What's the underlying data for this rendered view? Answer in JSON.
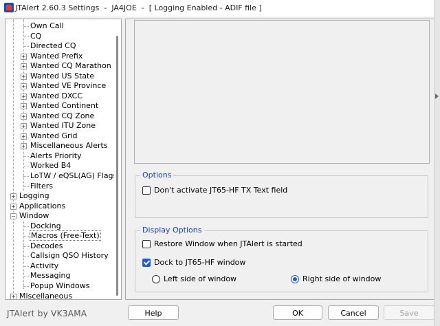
{
  "window": {
    "title": "JTAlert 2.60.3 Settings  -  JA4JOE  -  [ Logging Enabled - ADIF file ]"
  },
  "tree": {
    "items": [
      {
        "label": "Own Call"
      },
      {
        "label": "CQ"
      },
      {
        "label": "Directed CQ"
      },
      {
        "label": "Wanted Prefix"
      },
      {
        "label": "Wanted CQ Marathon"
      },
      {
        "label": "Wanted US State"
      },
      {
        "label": "Wanted VE Province"
      },
      {
        "label": "Wanted DXCC"
      },
      {
        "label": "Wanted Continent"
      },
      {
        "label": "Wanted CQ Zone"
      },
      {
        "label": "Wanted ITU Zone"
      },
      {
        "label": "Wanted Grid"
      },
      {
        "label": "Miscellaneous Alerts"
      },
      {
        "label": "Alerts Priority"
      },
      {
        "label": "Worked B4"
      },
      {
        "label": "LoTW / eQSL(AG) Flags"
      },
      {
        "label": "Filters"
      },
      {
        "label": "Logging"
      },
      {
        "label": "Applications"
      },
      {
        "label": "Window"
      },
      {
        "label": "Docking"
      },
      {
        "label": "Macros (Free-Text)"
      },
      {
        "label": "Decodes"
      },
      {
        "label": "Callsign QSO History"
      },
      {
        "label": "Activity"
      },
      {
        "label": "Messaging"
      },
      {
        "label": "Popup Windows"
      },
      {
        "label": "Miscellaneous"
      }
    ]
  },
  "options": {
    "legend": "Options",
    "dont_activate": {
      "label": "Don't activate JT65-HF TX Text field",
      "checked": false
    }
  },
  "display_options": {
    "legend": "Display Options",
    "restore_window": {
      "label": "Restore Window when JTAlert is started",
      "checked": false
    },
    "dock_window": {
      "label": "Dock to JT65-HF window",
      "checked": true
    },
    "left_side": {
      "label": "Left side of window",
      "selected": false
    },
    "right_side": {
      "label": "Right side of window",
      "selected": true
    }
  },
  "footer": {
    "credit": "JTAlert by VK3AMA",
    "help_label": "Help",
    "ok_label": "OK",
    "cancel_label": "Cancel",
    "save_label": "Save"
  },
  "colors": {
    "accent": "#1f5bd6",
    "legend_text": "#1a3fb0"
  }
}
